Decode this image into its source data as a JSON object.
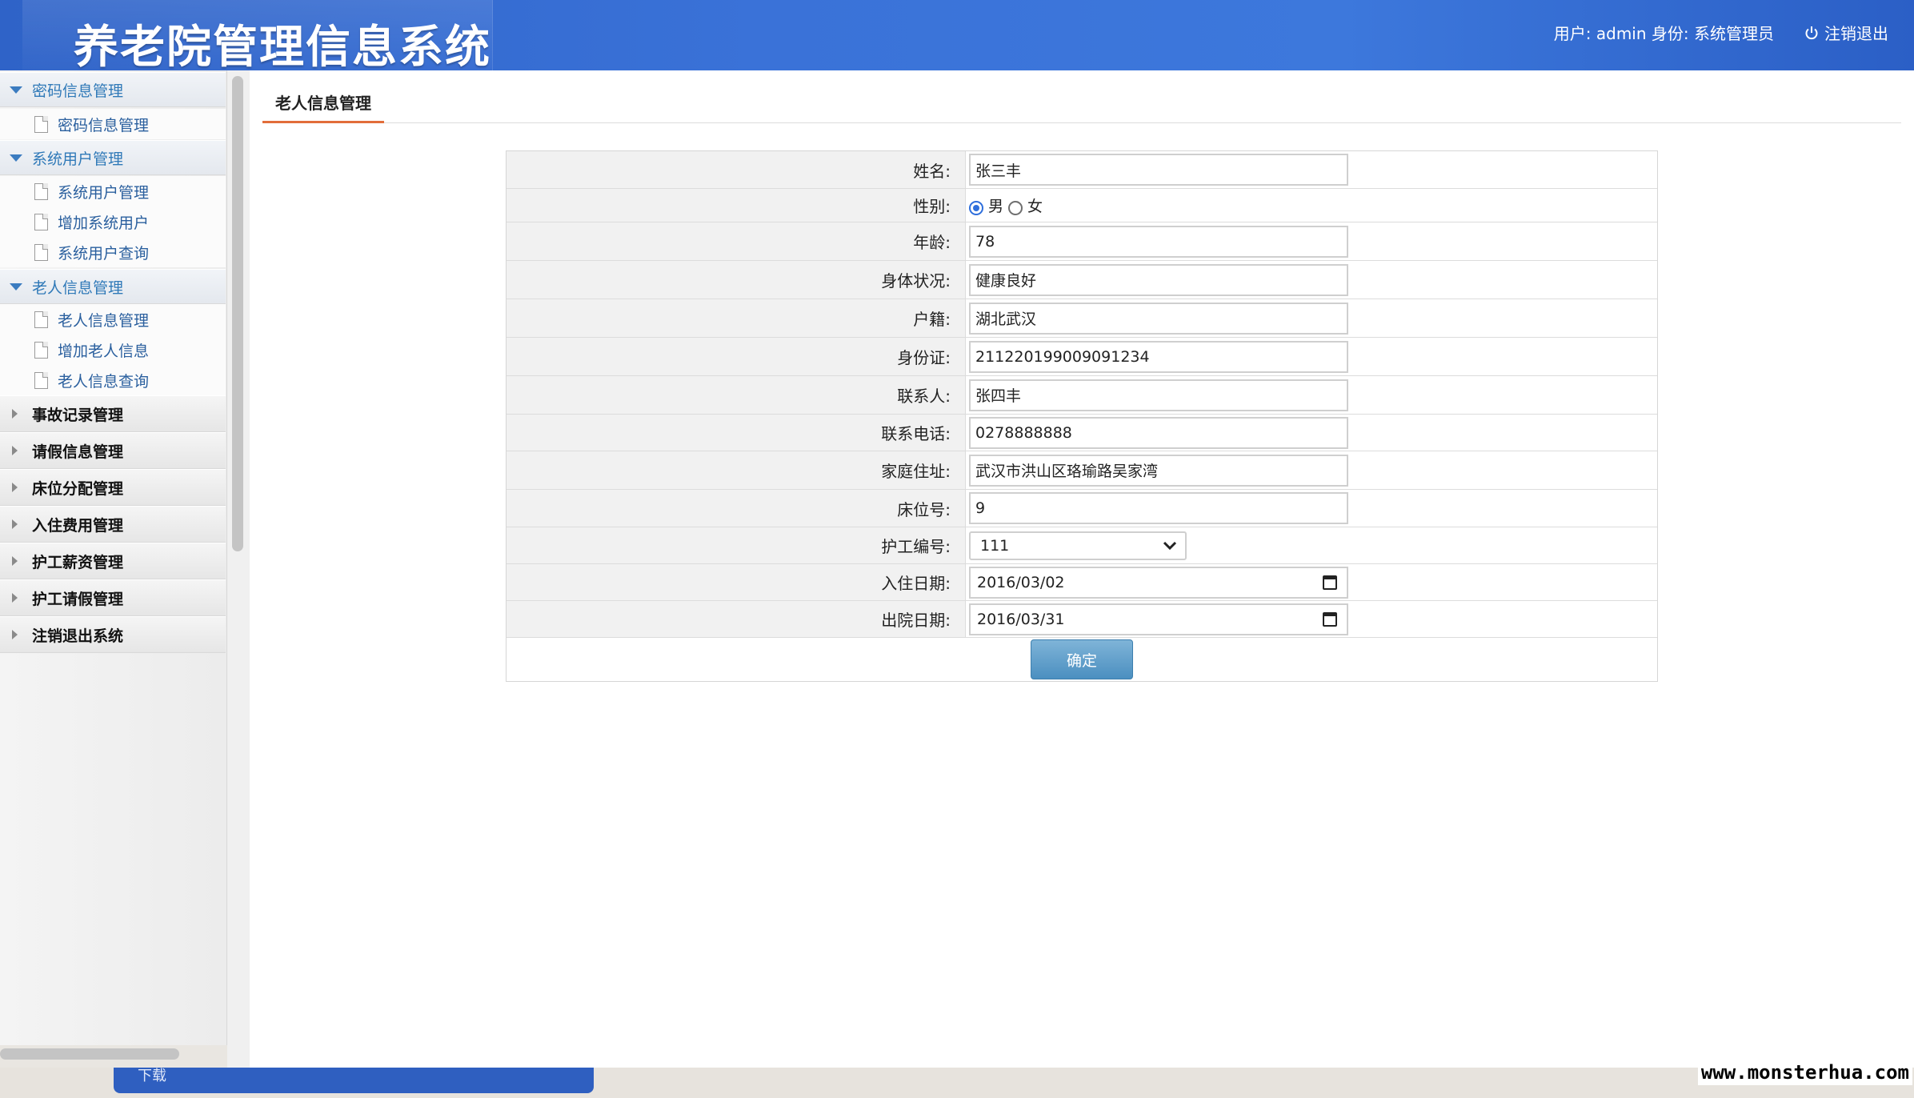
{
  "header": {
    "title": "养老院管理信息系统",
    "user_info": "用户: admin 身份: 系统管理员",
    "logout": "注销退出"
  },
  "sidebar": {
    "groups": [
      {
        "label": "密码信息管理",
        "expanded": true,
        "items": [
          {
            "label": "密码信息管理"
          }
        ]
      },
      {
        "label": "系统用户管理",
        "expanded": true,
        "items": [
          {
            "label": "系统用户管理"
          },
          {
            "label": "增加系统用户"
          },
          {
            "label": "系统用户查询"
          }
        ]
      },
      {
        "label": "老人信息管理",
        "expanded": true,
        "items": [
          {
            "label": "老人信息管理"
          },
          {
            "label": "增加老人信息"
          },
          {
            "label": "老人信息查询"
          }
        ]
      },
      {
        "label": "事故记录管理",
        "expanded": false,
        "items": []
      },
      {
        "label": "请假信息管理",
        "expanded": false,
        "items": []
      },
      {
        "label": "床位分配管理",
        "expanded": false,
        "items": []
      },
      {
        "label": "入住费用管理",
        "expanded": false,
        "items": []
      },
      {
        "label": "护工薪资管理",
        "expanded": false,
        "items": []
      },
      {
        "label": "护工请假管理",
        "expanded": false,
        "items": []
      },
      {
        "label": "注销退出系统",
        "expanded": false,
        "items": []
      }
    ]
  },
  "main": {
    "tab": "老人信息管理",
    "form": {
      "name": {
        "label": "姓名:",
        "value": "张三丰"
      },
      "gender": {
        "label": "性别:",
        "options": [
          "男",
          "女"
        ],
        "selected": "男"
      },
      "age": {
        "label": "年龄:",
        "value": "78"
      },
      "health": {
        "label": "身体状况:",
        "value": "健康良好"
      },
      "domicile": {
        "label": "户籍:",
        "value": "湖北武汉"
      },
      "id_card": {
        "label": "身份证:",
        "value": "211220199009091234"
      },
      "contact": {
        "label": "联系人:",
        "value": "张四丰"
      },
      "phone": {
        "label": "联系电话:",
        "value": "0278888888"
      },
      "address": {
        "label": "家庭住址:",
        "value": "武汉市洪山区珞瑜路吴家湾"
      },
      "bed_no": {
        "label": "床位号:",
        "value": "9"
      },
      "nurse_no": {
        "label": "护工编号:",
        "value": "111"
      },
      "checkin_date": {
        "label": "入住日期:",
        "value": "2016/03/02"
      },
      "checkout_date": {
        "label": "出院日期:",
        "value": "2016/03/31"
      },
      "submit": "确定"
    }
  },
  "background_page": {
    "button_fragment": "下载"
  },
  "watermark": "www.monsterhua.com",
  "colors": {
    "header_blue": "#3a72d8",
    "link_blue": "#2f79b8",
    "tab_underline": "#e26d3a",
    "button": "#5a9bc8"
  }
}
